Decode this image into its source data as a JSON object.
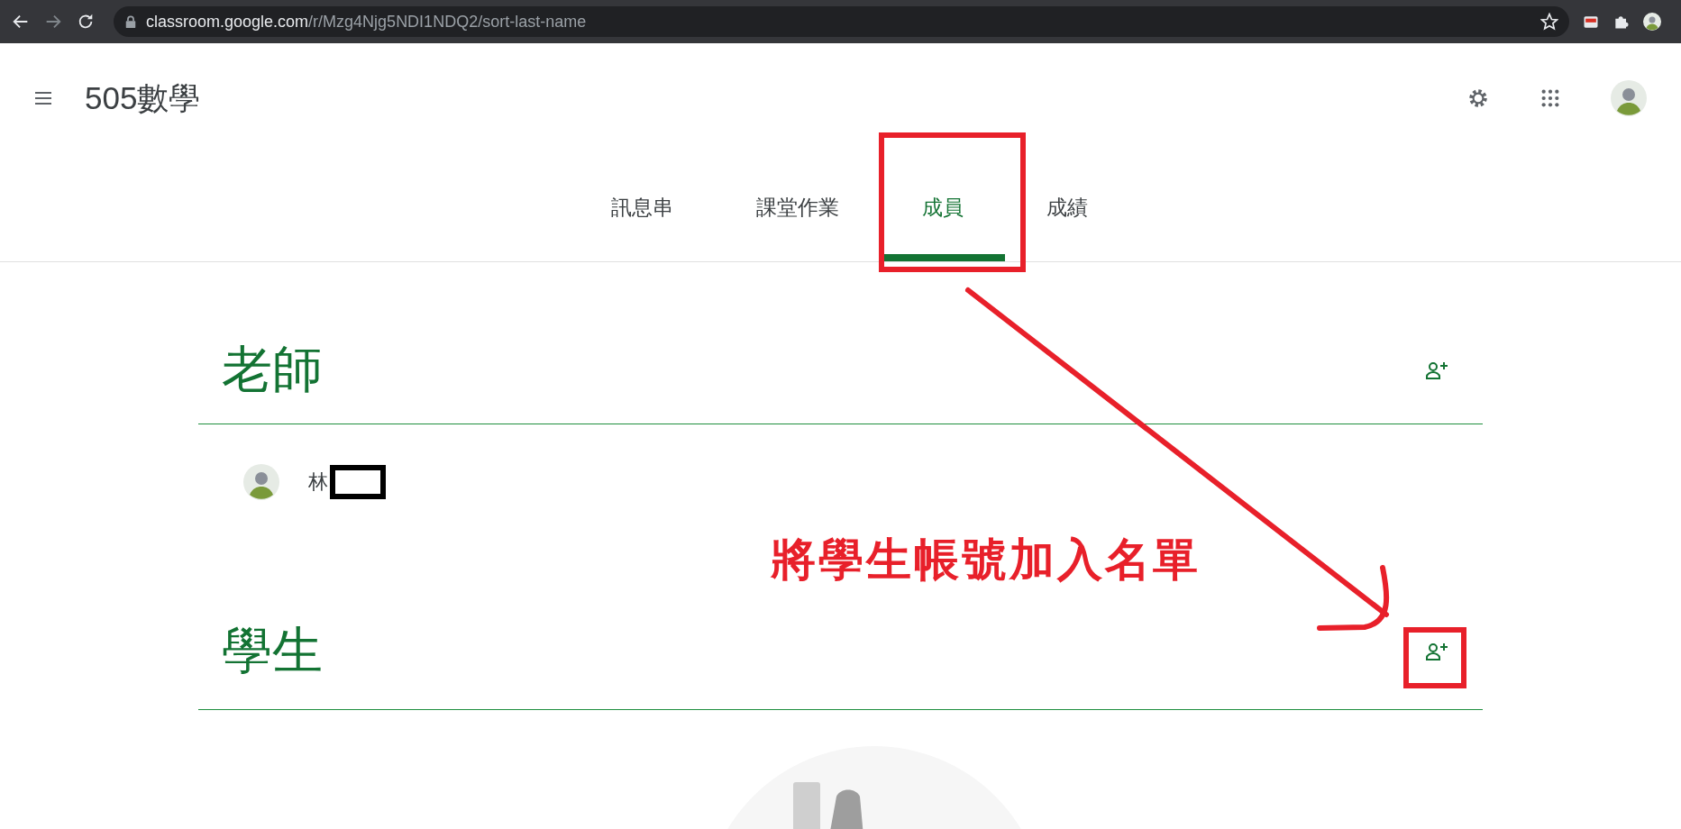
{
  "browser": {
    "url_host": "classroom.google.com",
    "url_path": "/r/Mzg4Njg5NDI1NDQ2/sort-last-name"
  },
  "header": {
    "title": "505數學"
  },
  "tabs": [
    {
      "label": "訊息串",
      "selected": false
    },
    {
      "label": "課堂作業",
      "selected": false
    },
    {
      "label": "成員",
      "selected": true
    },
    {
      "label": "成績",
      "selected": false
    }
  ],
  "sections": [
    {
      "heading": "老師",
      "members": [
        {
          "name": "林",
          "redacted": true
        }
      ]
    },
    {
      "heading": "學生"
    }
  ],
  "annotation": {
    "text": "將學生帳號加入名單"
  }
}
